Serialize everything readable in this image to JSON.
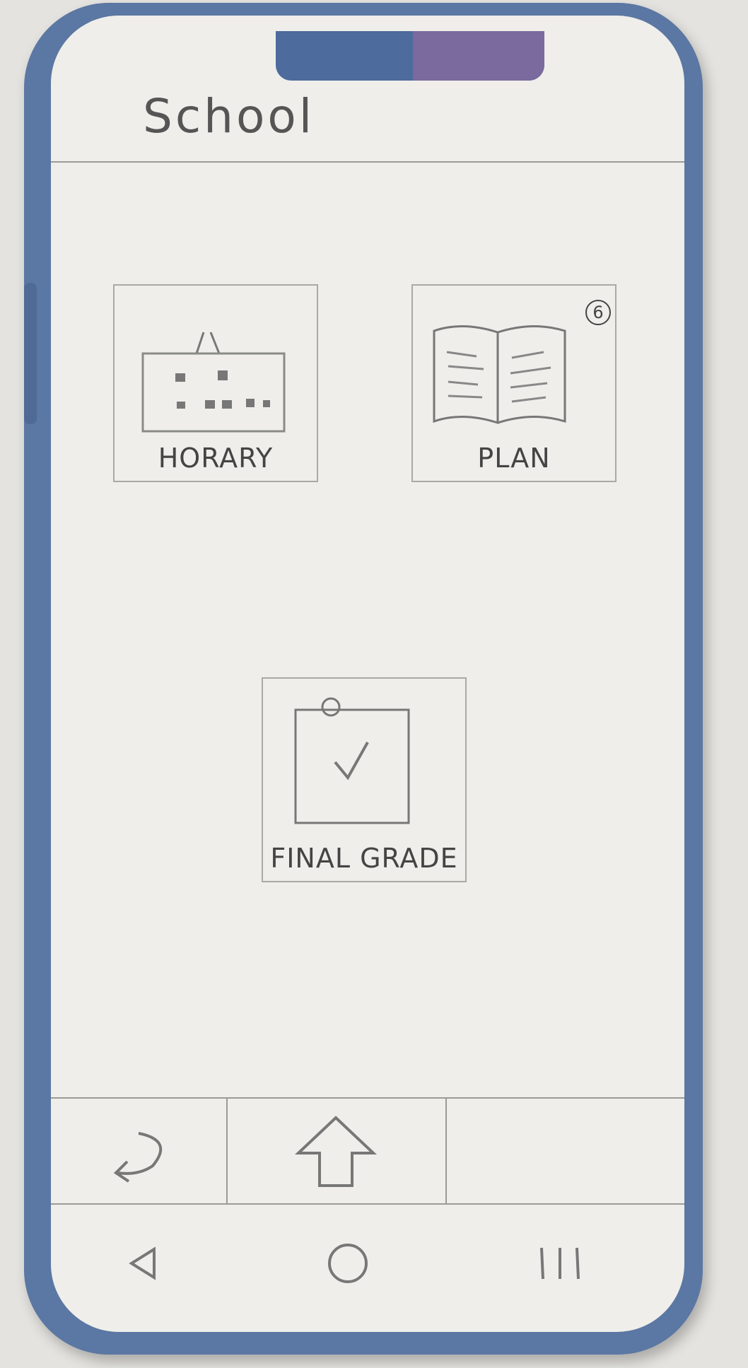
{
  "app": {
    "title": "School"
  },
  "tiles": [
    {
      "label": "HORARY",
      "icon": "calendar-icon"
    },
    {
      "label": "PLAN",
      "icon": "open-book-icon",
      "badge": "6"
    },
    {
      "label": "FINAL GRADE",
      "icon": "clipboard-check-icon"
    }
  ],
  "bottom_bar": [
    {
      "icon": "return-arrow-icon"
    },
    {
      "icon": "up-arrow-icon"
    },
    {
      "icon": ""
    }
  ],
  "system_nav": [
    {
      "icon": "back-triangle-icon"
    },
    {
      "icon": "home-circle-icon"
    },
    {
      "icon": "recent-apps-icon"
    }
  ]
}
